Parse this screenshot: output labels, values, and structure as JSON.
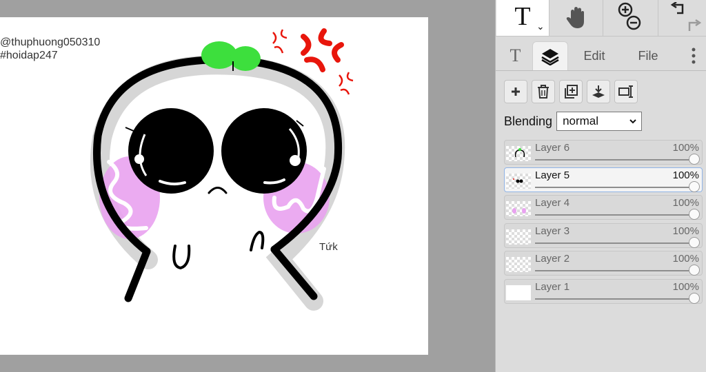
{
  "canvas": {
    "credit_line1": "@thuphuong050310",
    "credit_line2": "#hoidap247",
    "signature": "Tứk"
  },
  "toolbar": {
    "tools": [
      {
        "name": "text-tool",
        "icon": "text-T-icon"
      },
      {
        "name": "hand-tool",
        "icon": "hand-icon"
      },
      {
        "name": "zoom-tool",
        "icon": "zoom-in-out-icon"
      },
      {
        "name": "undo-redo",
        "icon": "undo-redo-icon"
      }
    ]
  },
  "tabs": {
    "text_tab_icon": "text-T-icon",
    "layers_tab_icon": "layers-icon",
    "edit": "Edit",
    "file": "File",
    "more_icon": "more-vertical-icon"
  },
  "layer_actions": [
    "add-layer-icon",
    "delete-layer-icon",
    "duplicate-layer-icon",
    "merge-down-icon",
    "layer-properties-icon"
  ],
  "blending": {
    "label": "Blending",
    "value": "normal"
  },
  "layers": [
    {
      "name": "Layer 6",
      "opacity": "100%",
      "opacity_value": 1.0,
      "active": false
    },
    {
      "name": "Layer 5",
      "opacity": "100%",
      "opacity_value": 1.0,
      "active": true
    },
    {
      "name": "Layer 4",
      "opacity": "100%",
      "opacity_value": 1.0,
      "active": false
    },
    {
      "name": "Layer 3",
      "opacity": "100%",
      "opacity_value": 1.0,
      "active": false
    },
    {
      "name": "Layer 2",
      "opacity": "100%",
      "opacity_value": 1.0,
      "active": false
    },
    {
      "name": "Layer 1",
      "opacity": "100%",
      "opacity_value": 1.0,
      "active": false
    }
  ],
  "colors": {
    "stroke": "#000000",
    "blush": "#e9a2f0",
    "leaf": "#3ddf3d",
    "anger": "#e8160c",
    "shadow": "#cfcfcf",
    "panel": "#dcdcdc",
    "workspace": "#a0a0a0"
  }
}
